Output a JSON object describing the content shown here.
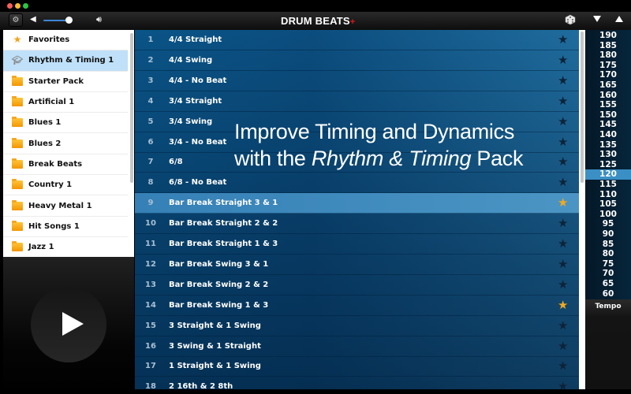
{
  "app": {
    "title": "DRUM BEATS",
    "title_suffix": "+"
  },
  "toolbar": {
    "settings_icon": "gear-icon",
    "volume_low_icon": "speaker-low-icon",
    "volume_high_icon": "speaker-high-icon",
    "volume_level": 0.85,
    "random_icon": "dice-icon",
    "next_icon": "arrow-down-icon",
    "prev_icon": "arrow-up-icon"
  },
  "sidebar": {
    "items": [
      {
        "label": "Favorites",
        "icon": "star-icon",
        "selected": false
      },
      {
        "label": "Rhythm & Timing 1",
        "icon": "graduation-cap-icon",
        "selected": true
      },
      {
        "label": "Starter Pack",
        "icon": "folder-icon",
        "selected": false
      },
      {
        "label": "Artificial 1",
        "icon": "folder-icon",
        "selected": false
      },
      {
        "label": "Blues 1",
        "icon": "folder-icon",
        "selected": false
      },
      {
        "label": "Blues 2",
        "icon": "folder-icon",
        "selected": false
      },
      {
        "label": "Break Beats",
        "icon": "folder-icon",
        "selected": false
      },
      {
        "label": "Country 1",
        "icon": "folder-icon",
        "selected": false
      },
      {
        "label": "Heavy Metal 1",
        "icon": "folder-icon",
        "selected": false
      },
      {
        "label": "Hit Songs 1",
        "icon": "folder-icon",
        "selected": false
      },
      {
        "label": "Jazz 1",
        "icon": "folder-icon",
        "selected": false
      }
    ]
  },
  "player": {
    "play_icon": "play-icon"
  },
  "beats": [
    {
      "num": "1",
      "name": "4/4 Straight",
      "favorite": false,
      "selected": false
    },
    {
      "num": "2",
      "name": "4/4 Swing",
      "favorite": false,
      "selected": false
    },
    {
      "num": "3",
      "name": "4/4 - No Beat",
      "favorite": false,
      "selected": false
    },
    {
      "num": "4",
      "name": "3/4 Straight",
      "favorite": false,
      "selected": false
    },
    {
      "num": "5",
      "name": "3/4 Swing",
      "favorite": false,
      "selected": false
    },
    {
      "num": "6",
      "name": "3/4 - No Beat",
      "favorite": false,
      "selected": false
    },
    {
      "num": "7",
      "name": "6/8",
      "favorite": false,
      "selected": false
    },
    {
      "num": "8",
      "name": "6/8 - No Beat",
      "favorite": false,
      "selected": false
    },
    {
      "num": "9",
      "name": "Bar Break Straight 3 & 1",
      "favorite": true,
      "selected": true
    },
    {
      "num": "10",
      "name": "Bar Break Straight 2 & 2",
      "favorite": false,
      "selected": false
    },
    {
      "num": "11",
      "name": "Bar Break Straight 1 & 3",
      "favorite": false,
      "selected": false
    },
    {
      "num": "12",
      "name": "Bar Break Swing 3 & 1",
      "favorite": false,
      "selected": false
    },
    {
      "num": "13",
      "name": "Bar Break Swing 2 & 2",
      "favorite": false,
      "selected": false
    },
    {
      "num": "14",
      "name": "Bar Break Swing 1 & 3",
      "favorite": true,
      "selected": false
    },
    {
      "num": "15",
      "name": "3 Straight & 1 Swing",
      "favorite": false,
      "selected": false
    },
    {
      "num": "16",
      "name": "3 Swing & 1 Straight",
      "favorite": false,
      "selected": false
    },
    {
      "num": "17",
      "name": "1 Straight & 1 Swing",
      "favorite": false,
      "selected": false
    },
    {
      "num": "18",
      "name": "2 16th & 2 8th",
      "favorite": false,
      "selected": false
    }
  ],
  "promo": {
    "line1": "Improve Timing and Dynamics",
    "line2_prefix": "with the ",
    "line2_italic": "Rhythm & Timing",
    "line2_suffix": " Pack"
  },
  "tempo": {
    "label": "Tempo",
    "selected": "120",
    "values": [
      "190",
      "185",
      "180",
      "175",
      "170",
      "165",
      "160",
      "155",
      "150",
      "145",
      "140",
      "135",
      "130",
      "125",
      "120",
      "115",
      "110",
      "105",
      "100",
      "95",
      "90",
      "85",
      "80",
      "75",
      "70",
      "65",
      "60"
    ]
  },
  "colors": {
    "accent_blue": "#3a8fc4",
    "favorite_star": "#f5a81b",
    "sidebar_selected": "#bfe0f8",
    "title_plus": "#e01818"
  }
}
